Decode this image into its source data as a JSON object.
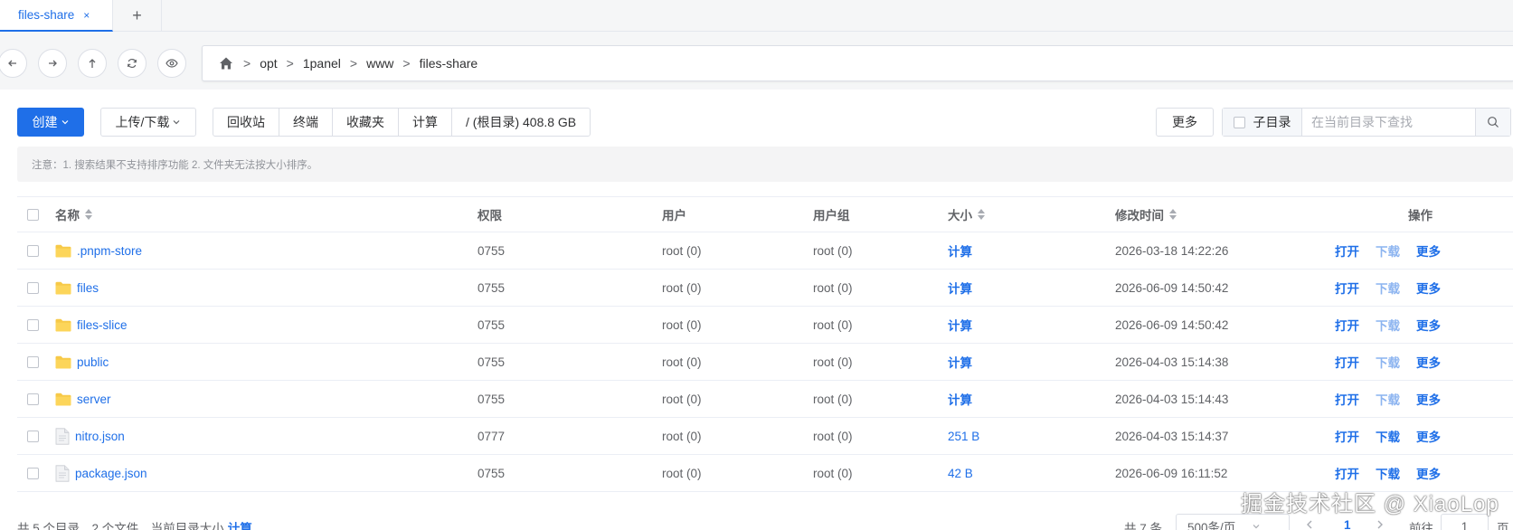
{
  "tabs": [
    {
      "label": "files-share",
      "close": "×"
    }
  ],
  "tab_add": "+",
  "nav": {
    "back_icon": "arrow-left-icon",
    "forward_icon": "arrow-right-icon",
    "up_icon": "arrow-up-icon",
    "refresh_icon": "refresh-icon",
    "view_icon": "eye-icon"
  },
  "breadcrumb": {
    "home_icon": "home-icon",
    "separator": ">",
    "items": [
      "opt",
      "1panel",
      "www",
      "files-share"
    ]
  },
  "toolbar": {
    "create": "创建",
    "upload_download": "上传/下载",
    "group": [
      "回收站",
      "终端",
      "收藏夹",
      "计算",
      "/ (根目录) 408.8 GB"
    ],
    "more": "更多",
    "subdir": "子目录",
    "search_placeholder": "在当前目录下查找"
  },
  "notice": "注意：1. 搜索结果不支持排序功能 2. 文件夹无法按大小排序。",
  "table": {
    "headers": {
      "name": "名称",
      "perm": "权限",
      "user": "用户",
      "group": "用户组",
      "size": "大小",
      "time": "修改时间",
      "actions": "操作"
    },
    "rows": [
      {
        "name": ".pnpm-store",
        "type": "folder",
        "perm": "0755",
        "user": "root (0)",
        "group": "root (0)",
        "size": "计算",
        "time": "2026-03-18 14:22:26",
        "download_enabled": false
      },
      {
        "name": "files",
        "type": "folder",
        "perm": "0755",
        "user": "root (0)",
        "group": "root (0)",
        "size": "计算",
        "time": "2026-06-09 14:50:42",
        "download_enabled": false
      },
      {
        "name": "files-slice",
        "type": "folder",
        "perm": "0755",
        "user": "root (0)",
        "group": "root (0)",
        "size": "计算",
        "time": "2026-06-09 14:50:42",
        "download_enabled": false
      },
      {
        "name": "public",
        "type": "folder",
        "perm": "0755",
        "user": "root (0)",
        "group": "root (0)",
        "size": "计算",
        "time": "2026-04-03 15:14:38",
        "download_enabled": false
      },
      {
        "name": "server",
        "type": "folder",
        "perm": "0755",
        "user": "root (0)",
        "group": "root (0)",
        "size": "计算",
        "time": "2026-04-03 15:14:43",
        "download_enabled": false
      },
      {
        "name": "nitro.json",
        "type": "file",
        "perm": "0777",
        "user": "root (0)",
        "group": "root (0)",
        "size": "251 B",
        "time": "2026-04-03 15:14:37",
        "download_enabled": true
      },
      {
        "name": "package.json",
        "type": "file",
        "perm": "0755",
        "user": "root (0)",
        "group": "root (0)",
        "size": "42 B",
        "time": "2026-06-09 16:11:52",
        "download_enabled": true
      }
    ],
    "actions": {
      "open": "打开",
      "download": "下载",
      "more": "更多"
    }
  },
  "footer": {
    "summary": "共 5 个目录，2 个文件，当前目录大小",
    "summary_link": "计算",
    "total": "共 7 条",
    "page_size": "500条/页",
    "page": "1",
    "goto": "前往",
    "goto_value": "1",
    "page_unit": "页"
  },
  "watermark": "掘金技术社区 @ XiaoLop",
  "colors": {
    "primary": "#1f6fe8",
    "folder": "#f7c948"
  }
}
